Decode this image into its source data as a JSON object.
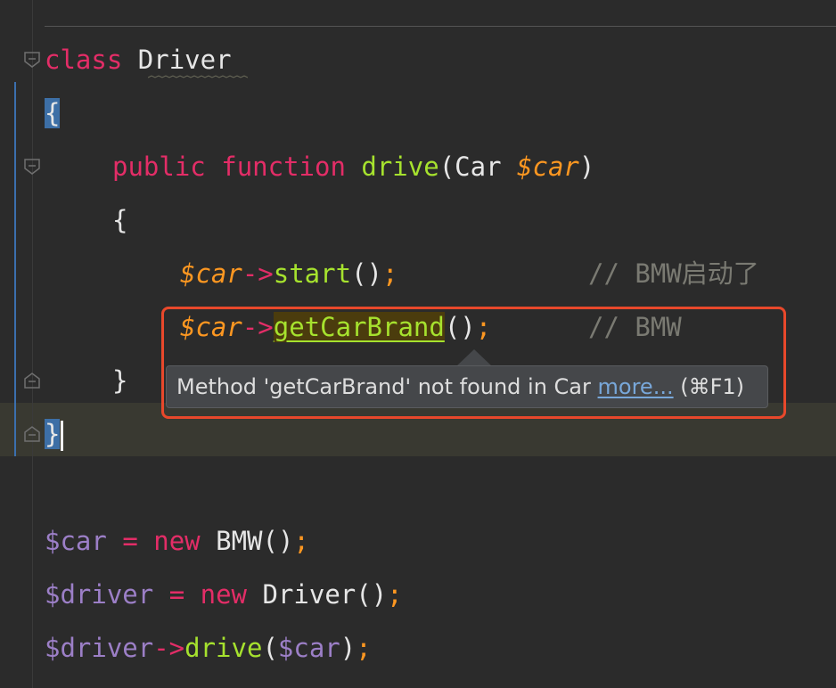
{
  "code": {
    "class_line": {
      "keyword": "class",
      "name": "Driver"
    },
    "open_brace": "{",
    "method_line": {
      "modifier": "public",
      "keyword": "function",
      "name": "drive",
      "open_paren": "(",
      "param_type": "Car",
      "param_var": "$car",
      "close_paren": ")"
    },
    "method_open_brace": "{",
    "call1": {
      "var": "$car",
      "arrow": "->",
      "method": "start",
      "parens": "()",
      "semi": ";",
      "comment": "// BMW启动了"
    },
    "call2": {
      "var": "$car",
      "arrow": "->",
      "method": "getCarBrand",
      "parens": "()",
      "semi": ";",
      "comment": "// BMW"
    },
    "method_close_brace": "}",
    "close_brace": "}",
    "assign_car": {
      "var": "$car",
      "eq": "=",
      "kw": "new",
      "cls": "BMW",
      "parens": "()",
      "semi": ";"
    },
    "assign_driver": {
      "var": "$driver",
      "eq": "=",
      "kw": "new",
      "cls": "Driver",
      "parens": "()",
      "semi": ";"
    },
    "drive_call": {
      "var": "$driver",
      "arrow": "->",
      "method": "drive",
      "open_paren": "(",
      "arg": "$car",
      "close_paren": ")",
      "semi": ";"
    }
  },
  "tooltip": {
    "message": "Method 'getCarBrand' not found in Car",
    "link": "more...",
    "shortcut": "(⌘F1)"
  },
  "colors": {
    "background": "#2b2b2b",
    "keyword": "#e32d67",
    "function": "#a6e22e",
    "variable": "#fd9721",
    "comment": "#7a7a72",
    "annotation_box": "#e8482b"
  }
}
